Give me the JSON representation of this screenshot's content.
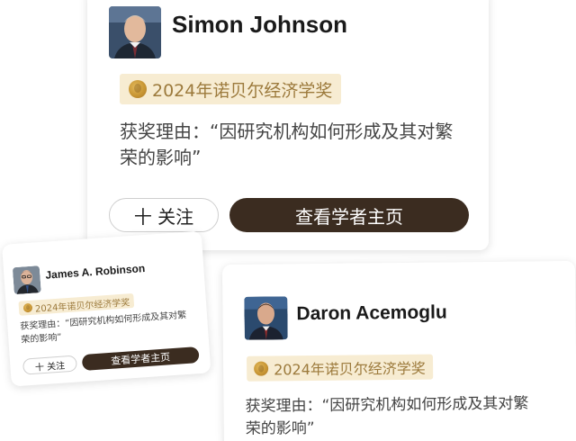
{
  "cards": [
    {
      "name": "Simon Johnson",
      "award": "2024年诺贝尔经济学奖",
      "reason_line1": "获奖理由：“因研究机构如何形成及其对繁",
      "reason_line2": "荣的影响”",
      "follow_label": "十 关注",
      "view_label": "查看学者主页"
    },
    {
      "name": "James A. Robinson",
      "award": "2024年诺贝尔经济学奖",
      "reason_line1": "获奖理由：“因研究机构如何形成及其对繁",
      "reason_line2": "荣的影响”",
      "follow_label": "十 关注",
      "view_label": "查看学者主页"
    },
    {
      "name": "Daron Acemoglu",
      "award": "2024年诺贝尔经济学奖",
      "reason_line1": "获奖理由：“因研究机构如何形成及其对繁",
      "reason_line2": "荣的影响”"
    }
  ],
  "colors": {
    "award_bg": "#f7ecd2",
    "award_text": "#9c7a3c",
    "view_button_bg": "#3b2c20"
  },
  "icons": {
    "medal": "medal-icon"
  }
}
